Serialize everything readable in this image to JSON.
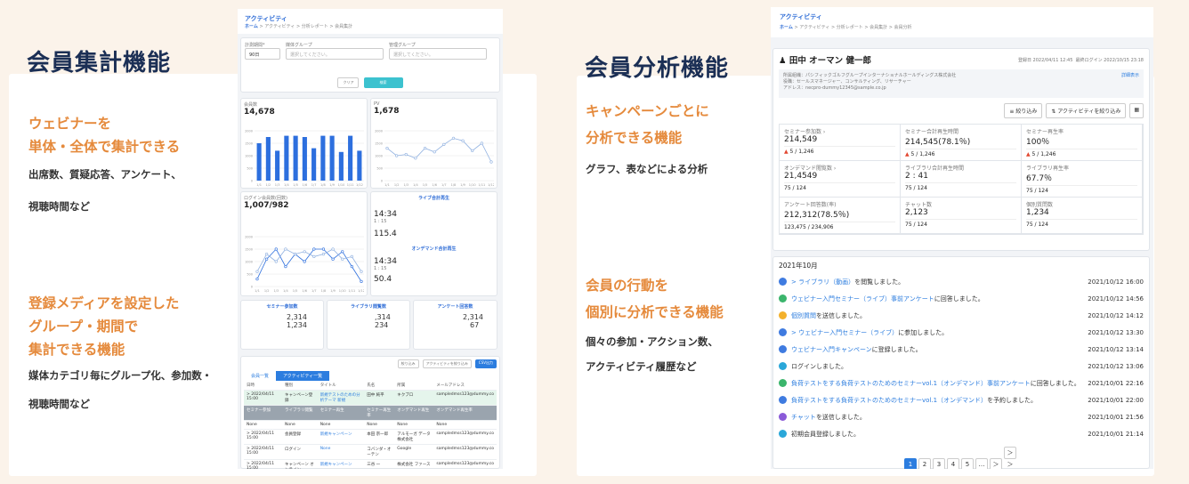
{
  "left": {
    "heading": "会員集計機能",
    "feature1": {
      "line1": "ウェビナーを",
      "line2": "単体・全体で集計できる",
      "desc1": "出席数、質疑応答、アンケート、",
      "desc2": "視聴時間など"
    },
    "feature2": {
      "line1": "登録メディアを設定した",
      "line2": "グループ・期間で",
      "line3": "集計できる機能",
      "desc1": "媒体カテゴリ毎にグループ化、参加数・",
      "desc2": "視聴時間など"
    }
  },
  "right": {
    "heading": "会員分析機能",
    "feature1": {
      "line1": "キャンペーンごとに",
      "line2": "分析できる機能",
      "desc": "グラフ、表などによる分析"
    },
    "feature2": {
      "line1": "会員の行動を",
      "line2": "個別に分析できる機能",
      "desc1": "個々の参加・アクション数、",
      "desc2": "アクティビティ履歴など"
    }
  },
  "s1": {
    "title": "アクティビティ",
    "crumb_home": "ホーム",
    "crumb_rest": "> アクティビティ > 分析レポート > 会員集計",
    "f_period": "計測期間*",
    "f_period_val": "90日",
    "f_group": "媒体グループ",
    "f_group_ph": "選択してください。",
    "f_mgmt": "管理グループ",
    "f_mgmt_ph": "選択してください。",
    "clear": "クリア",
    "search": "検索",
    "c1_label": "会員数",
    "c1_value": "14,678",
    "c2_label": "PV",
    "c2_value": "1,678",
    "c3_label": "ログイン会員数(回数)",
    "c3_value": "1,007/982",
    "live_title": "ライブ合計再生",
    "live_time": "14",
    "live_min": "34",
    "live_sub": "1 : 15",
    "live_rate": "115.4",
    "od_title": "オンデマンド合計再生",
    "od_time": "14",
    "od_min": "34",
    "od_sub": "1 : 15",
    "od_rate": "50.4",
    "sem_title": "セミナー参加数",
    "sem_total": "2,314",
    "sem_avg": "1,234",
    "lib_title": "ライブラリ閲覧数",
    "lib_total": ",314",
    "lib_avg": "234",
    "ans_title": "アンケート回答数",
    "ans_total": "2,314",
    "ans_avg": "67",
    "filter": "絞り込み",
    "act_filter": "アクティビティを絞り込み",
    "csv": "CSV出力",
    "tab1": "会員一覧",
    "tab2": "アクティビティ一覧",
    "th": [
      "日時",
      "種別",
      "タイトル",
      "氏名",
      "所属",
      "メールアドレス"
    ],
    "rows": [
      [
        "> 2022/04/11 15:00",
        "キャンペーン登録",
        "新規テストのための分析テーマ 新規",
        "田中 純平",
        "キクブロ",
        "sampledmss123@dummy.co"
      ],
      [
        "> 2022/04/11 15:00",
        "会員登録",
        "新規キャンペーン",
        "本田 宗一郎",
        "アルモーガ データ株式会社",
        "sampledmss123@dummy.co"
      ],
      [
        "> 2022/04/11 15:00",
        "ログイン",
        "None",
        "コバンダ・オーテン",
        "Google",
        "sampledmss123@dummy.co"
      ],
      [
        "> 2022/04/11 15:00",
        "キャンペーン オンライン",
        "新規キャンペーン",
        "三谷 一",
        "株式会社 ファース",
        "sampledmss123@dummy.co"
      ]
    ],
    "subth": [
      "セミナー参加",
      "ライブラリ閲覧",
      "セミナー再生",
      "セミナー再生率",
      "オンデマンド再生",
      "オンデマンド再生率"
    ],
    "none": "None"
  },
  "s2": {
    "title": "アクティビティ",
    "crumb_home": "ホーム",
    "crumb_rest": "> アクティビティ > 分析レポート > 会員集計 > 会員分析",
    "reg": "登録日 2022/04/11 12:45",
    "login": "最終ログイン 2022/10/15 23:18",
    "name": "田中 オーマン 健一郎",
    "company": "所属組織：パシフィックゴルフグループインターナショナルホールディングス株式会社",
    "job": "役職：セールスマネージャー、コンサルティング、リサーチャー",
    "addr": "アドレス：necpro-dummy12345@sample.co.jp",
    "detail": "詳細表示",
    "filter": "絞り込み",
    "act_filter": "アクティビティを絞り込み",
    "stats": [
      [
        "セミナー参加数 ›",
        "214,549",
        "5",
        "1,246"
      ],
      [
        "セミナー合計再生時間",
        "214,545(78.1％)",
        "5",
        "1,246"
      ],
      [
        "セミナー再生率",
        "100％",
        "5",
        "1,246"
      ],
      [
        "オンデマンド閲覧数 ›",
        "21,4549",
        "75",
        "124"
      ],
      [
        "ライブラリ合計再生時間",
        "2 : 41",
        "75",
        "124"
      ],
      [
        "ライブラリ再生率",
        "67.7％",
        "75",
        "124"
      ],
      [
        "アンケート回答数(率)",
        "212,312(78.5％)",
        "123,475",
        "234,906"
      ],
      [
        "チャット数",
        "2,123",
        "75",
        "124"
      ],
      [
        "個別質問数",
        "1,234",
        "75",
        "124"
      ]
    ],
    "month": "2021年10月",
    "acts": [
      [
        "> ライブラリ（動画）",
        "を閲覧しました。",
        "2021/10/12 16:00",
        "#3f7be0"
      ],
      [
        "ウェビナー入門セミナー（ライブ）事前アンケート",
        "に回答しました。",
        "2021/10/12 14:56",
        "#3bb56c"
      ],
      [
        "個別質問",
        "を送信しました。",
        "2021/10/12 14:12",
        "#f3b12c"
      ],
      [
        "> ウェビナー入門セミナー（ライブ）",
        "に参加しました。",
        "2021/10/12 13:30",
        "#3f7be0"
      ],
      [
        "ウェビナー入門キャンペーン",
        "に登録しました。",
        "2021/10/12 13:14",
        "#3f7be0"
      ],
      [
        "",
        "ログインしました。",
        "2021/10/12 13:06",
        "#2aa7d9"
      ],
      [
        "負荷テストをする負荷テストのためのセミナーvol.1（オンデマンド）事前アンケート",
        "に回答しました。",
        "2021/10/01 22:16",
        "#3bb56c"
      ],
      [
        "負荷テストをする負荷テストのためのセミナーvol.1（オンデマンド）",
        "を予約しました。",
        "2021/10/01 22:00",
        "#3f7be0"
      ],
      [
        "チャット",
        "を送信しました。",
        "2021/10/01 21:56",
        "#8a5ad8"
      ],
      [
        "",
        "初期会員登録しました。",
        "2021/10/01 21:14",
        "#2aa7d9"
      ]
    ],
    "pages": [
      "1",
      "2",
      "3",
      "4",
      "5",
      "…",
      "＞",
      "＞＞"
    ]
  },
  "chart_data": [
    {
      "type": "bar",
      "title": "",
      "categories": [
        "1/1",
        "1/2",
        "1/3",
        "1/4",
        "1/5",
        "1/6",
        "1/7",
        "1/8",
        "1/9",
        "1/10",
        "1/11",
        "1/12"
      ],
      "values": [
        1500,
        1750,
        1200,
        1800,
        1800,
        1750,
        1300,
        1800,
        1800,
        1150,
        1800,
        1200
      ],
      "ylim": [
        0,
        2000
      ]
    },
    {
      "type": "line",
      "title": "",
      "categories": [
        "1/1",
        "1/2",
        "1/3",
        "1/4",
        "1/5",
        "1/6",
        "1/7",
        "1/8",
        "1/9",
        "1/10",
        "1/11",
        "1/12"
      ],
      "values": [
        1300,
        1000,
        1050,
        900,
        1300,
        1150,
        1450,
        1700,
        1600,
        1200,
        1500,
        750
      ],
      "ylim": [
        0,
        2000
      ]
    },
    {
      "type": "line",
      "title": "",
      "categories": [
        "1/1",
        "1/2",
        "1/3",
        "1/4",
        "1/5",
        "1/6",
        "1/7",
        "1/8",
        "1/9",
        "1/10",
        "1/11",
        "1/12"
      ],
      "series": [
        {
          "values": [
            300,
            1100,
            1500,
            800,
            1300,
            1000,
            1500,
            1500,
            1100,
            1400,
            800,
            200
          ]
        },
        {
          "values": [
            600,
            1300,
            1000,
            1500,
            1300,
            1400,
            1200,
            1300,
            1500,
            1100,
            1200,
            600
          ]
        }
      ],
      "ylim": [
        0,
        2000
      ]
    }
  ]
}
